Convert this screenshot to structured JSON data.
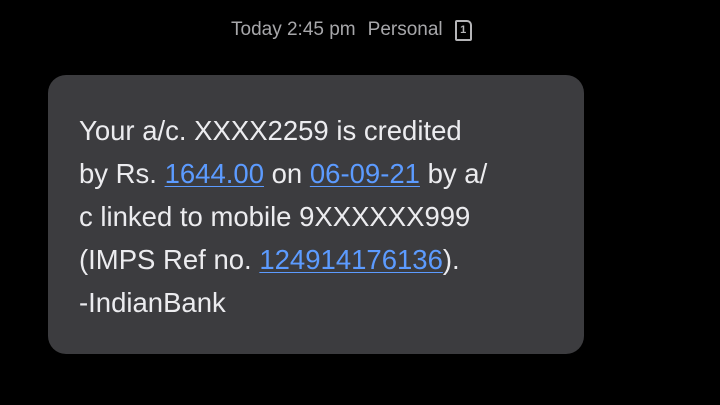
{
  "header": {
    "timestamp": "Today 2:45 pm",
    "sim_label": "Personal",
    "sim_number": "1"
  },
  "message": {
    "line1": "Your a/c. XXXX2259 is credited",
    "line2_prefix": "by Rs. ",
    "amount": "1644.00",
    "line2_mid": " on ",
    "date": "06-09-21",
    "line2_suffix": " by a/",
    "line3": "c linked to mobile 9XXXXXX999",
    "line4_prefix": "(IMPS Ref no. ",
    "ref_no": "124914176136",
    "line4_suffix": ").",
    "line5": "-IndianBank"
  },
  "colors": {
    "background": "#000000",
    "bubble": "#3c3c3f",
    "text": "#ececef",
    "link": "#5c9bff",
    "meta": "#a7a7aa"
  }
}
